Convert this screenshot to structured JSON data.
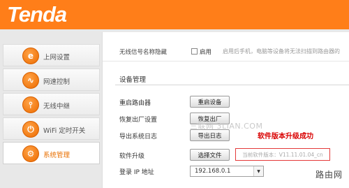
{
  "brand": {
    "logo": "Tenda"
  },
  "sidebar": {
    "items": [
      {
        "label": "上网设置",
        "icon": "internet-e-icon",
        "glyph": "e"
      },
      {
        "label": "网速控制",
        "icon": "speed-wave-icon",
        "glyph": "∿"
      },
      {
        "label": "无线中继",
        "icon": "wireless-relay-icon",
        "glyph": "⫯"
      },
      {
        "label": "WiFi 定时开关",
        "icon": "wifi-timer-icon",
        "glyph": "⏻"
      },
      {
        "label": "系统管理",
        "icon": "gear-icon",
        "glyph": "⚙"
      }
    ],
    "active_index": 4
  },
  "wireless_hide": {
    "label": "无线信号名称隐藏",
    "checkbox_label": "启用",
    "hint": "启用后手机，电脑等设备将无法扫描到路由器的"
  },
  "device_mgmt": {
    "title": "设备管理",
    "reboot": {
      "label": "重启路由器",
      "button": "重启设备"
    },
    "factory": {
      "label": "恢复出厂设置",
      "button": "恢复出厂"
    },
    "log": {
      "label": "导出系统日志",
      "button": "导出日志"
    },
    "upgrade": {
      "label": "软件升级",
      "button": "选择文件",
      "version": "当前软件版本：V11.11.01.04_cn"
    },
    "login_ip": {
      "label": "登录 IP 地址",
      "value": "192.168.0.1"
    }
  },
  "annotation": {
    "upgrade_success": "软件版本升级成功"
  },
  "watermarks": {
    "site": "三联网 3LIAN.COM",
    "corner": "路由网"
  },
  "colors": {
    "header": "#ff7e19",
    "accent": "#e96f00",
    "highlight_red": "#e43a3a"
  }
}
